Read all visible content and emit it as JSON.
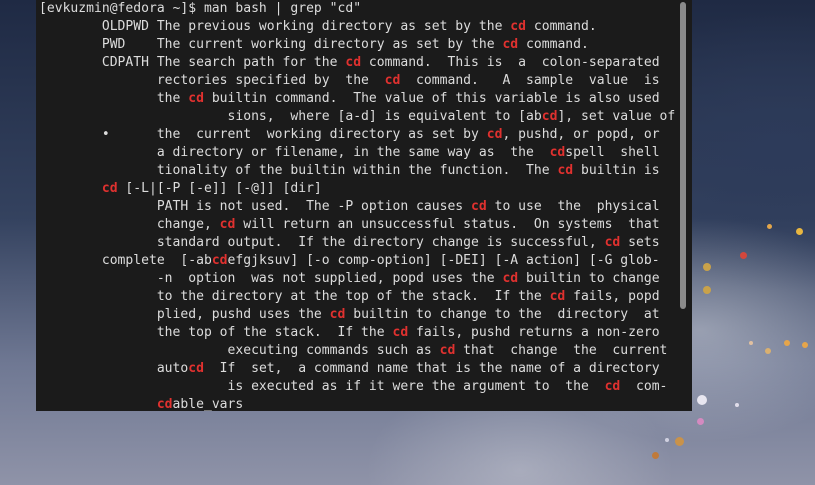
{
  "terminal": {
    "lines": [
      [
        {
          "t": "[evkuzmin@fedora ~]$ man bash | grep \"cd\""
        }
      ],
      [
        {
          "t": "        OLDPWD The previous working directory as set by the "
        },
        {
          "t": "cd",
          "h": true
        },
        {
          "t": " command."
        }
      ],
      [
        {
          "t": "        PWD    The current working directory as set by the "
        },
        {
          "t": "cd",
          "h": true
        },
        {
          "t": " command."
        }
      ],
      [
        {
          "t": "        CDPATH The search path for the "
        },
        {
          "t": "cd",
          "h": true
        },
        {
          "t": " command.  This is  a  colon-separated"
        }
      ],
      [
        {
          "t": "               rectories specified by  the  "
        },
        {
          "t": "cd",
          "h": true
        },
        {
          "t": "  command.   A  sample  value  is"
        }
      ],
      [
        {
          "t": "               the "
        },
        {
          "t": "cd",
          "h": true
        },
        {
          "t": " builtin command.  The value of this variable is also used"
        }
      ],
      [
        {
          "t": "                        sions,  where [a-d] is equivalent to [ab"
        },
        {
          "t": "cd",
          "h": true
        },
        {
          "t": "], set value of"
        }
      ],
      [
        {
          "t": "        •      the  current  working directory as set by "
        },
        {
          "t": "cd",
          "h": true
        },
        {
          "t": ", pushd, or popd, or"
        }
      ],
      [
        {
          "t": "               a directory or filename, in the same way as  the  "
        },
        {
          "t": "cd",
          "h": true
        },
        {
          "t": "spell  shell"
        }
      ],
      [
        {
          "t": "               tionality of the builtin within the function.  The "
        },
        {
          "t": "cd",
          "h": true
        },
        {
          "t": " builtin is"
        }
      ],
      [
        {
          "t": "        "
        },
        {
          "t": "cd",
          "h": true
        },
        {
          "t": " [-L|[-P [-e]] [-@]] [dir]"
        }
      ],
      [
        {
          "t": "               PATH is not used.  The -P option causes "
        },
        {
          "t": "cd",
          "h": true
        },
        {
          "t": " to use  the  physical"
        }
      ],
      [
        {
          "t": "               change, "
        },
        {
          "t": "cd",
          "h": true
        },
        {
          "t": " will return an unsuccessful status.  On systems  that"
        }
      ],
      [
        {
          "t": "               standard output.  If the directory change is successful, "
        },
        {
          "t": "cd",
          "h": true
        },
        {
          "t": " sets"
        }
      ],
      [
        {
          "t": "        complete  [-ab"
        },
        {
          "t": "cd",
          "h": true
        },
        {
          "t": "efgjksuv] [-o comp-option] [-DEI] [-A action] [-G glob-"
        }
      ],
      [
        {
          "t": "               -n  option  was not supplied, popd uses the "
        },
        {
          "t": "cd",
          "h": true
        },
        {
          "t": " builtin to change"
        }
      ],
      [
        {
          "t": "               to the directory at the top of the stack.  If the "
        },
        {
          "t": "cd",
          "h": true
        },
        {
          "t": " fails, popd"
        }
      ],
      [
        {
          "t": "               plied, pushd uses the "
        },
        {
          "t": "cd",
          "h": true
        },
        {
          "t": " builtin to change to the  directory  at"
        }
      ],
      [
        {
          "t": "               the top of the stack.  If the "
        },
        {
          "t": "cd",
          "h": true
        },
        {
          "t": " fails, pushd returns a non-zero"
        }
      ],
      [
        {
          "t": "                        executing commands such as "
        },
        {
          "t": "cd",
          "h": true
        },
        {
          "t": " that  change  the  current"
        }
      ],
      [
        {
          "t": "               auto"
        },
        {
          "t": "cd",
          "h": true
        },
        {
          "t": "  If  set,  a command name that is the name of a directory"
        }
      ],
      [
        {
          "t": "                        is executed as if it were the argument to  the  "
        },
        {
          "t": "cd",
          "h": true
        },
        {
          "t": "  com-"
        }
      ],
      [
        {
          "t": "               "
        },
        {
          "t": "cd",
          "h": true
        },
        {
          "t": "able_vars"
        }
      ]
    ]
  },
  "colors": {
    "highlight": "#e0312f",
    "text": "#dcdcdc",
    "terminal_bg": "#1b1b1b"
  }
}
